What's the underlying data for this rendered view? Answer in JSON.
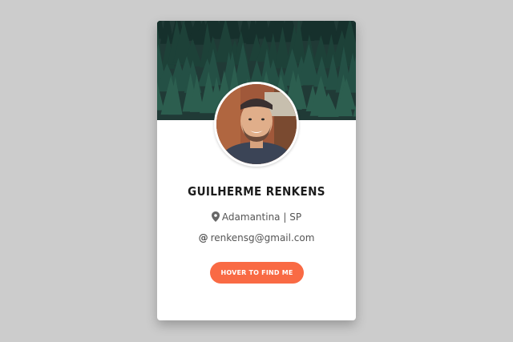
{
  "profile": {
    "name": "GUILHERME RENKENS",
    "location": "Adamantina | SP",
    "email": "renkensg@gmail.com",
    "email_icon": "@",
    "button_label": "HOVER TO FIND ME"
  },
  "icons": {
    "location": "map-pin-icon",
    "email": "at-sign-icon"
  },
  "colors": {
    "background": "#cccccc",
    "card": "#ffffff",
    "accent": "#f96a44",
    "cover": "#1f3a35",
    "name_text": "#1c1c1c",
    "info_text": "#555555"
  }
}
